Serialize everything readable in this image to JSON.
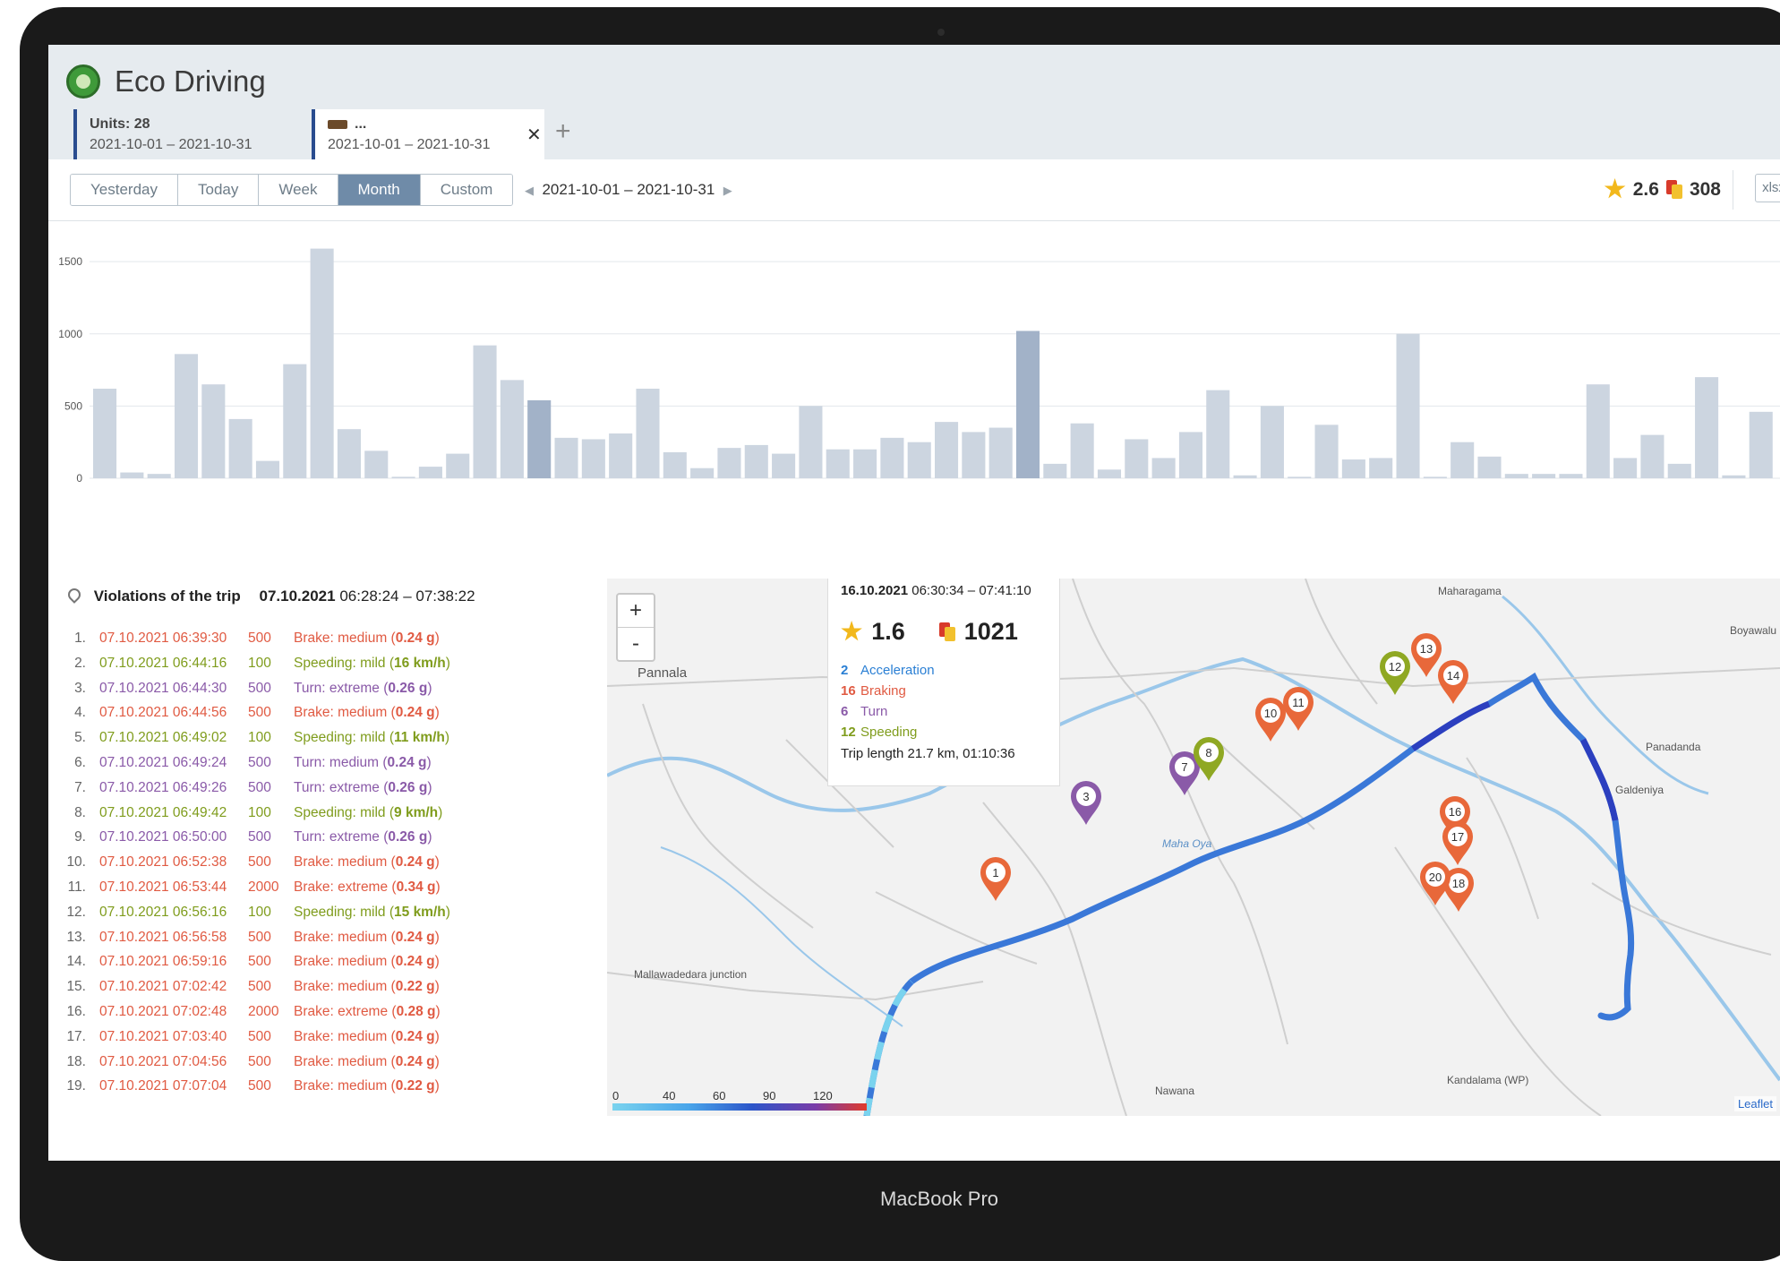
{
  "app": {
    "title": "Eco Driving"
  },
  "tabs": [
    {
      "line1": "Units: 28",
      "line2": "2021-10-01  –  2021-10-31"
    },
    {
      "line1": "...",
      "line2": "2021-10-01  –  2021-10-31"
    }
  ],
  "toolbar": {
    "periods": [
      "Yesterday",
      "Today",
      "Week",
      "Month",
      "Custom"
    ],
    "active_period": "Month",
    "date_range": "2021-10-01  –  2021-10-31",
    "rating": "2.6",
    "penalty": "308",
    "export_label": "xlsx"
  },
  "chart_data": {
    "type": "bar",
    "y_ticks": [
      "0",
      "500",
      "1000",
      "1500"
    ],
    "ylim": [
      0,
      1600
    ],
    "grid": true,
    "values": [
      620,
      40,
      30,
      860,
      650,
      410,
      120,
      790,
      1590,
      340,
      190,
      10,
      80,
      170,
      920,
      680,
      540,
      280,
      270,
      310,
      620,
      180,
      70,
      210,
      230,
      170,
      500,
      200,
      200,
      280,
      250,
      390,
      320,
      350,
      1020,
      100,
      380,
      60,
      270,
      140,
      320,
      610,
      20,
      500,
      10,
      370,
      130,
      140,
      1000,
      10,
      250,
      150,
      30,
      30,
      30,
      650,
      140,
      300,
      100,
      700,
      20,
      460
    ],
    "highlighted": [
      16,
      34
    ]
  },
  "violations": {
    "title": "Violations of the trip",
    "trip_date": "07.10.2021",
    "trip_time": "06:28:24 – 07:38:22",
    "items": [
      {
        "n": "1.",
        "time": "07.10.2021 06:39:30",
        "score": "500",
        "label": "Brake: medium (",
        "value": "0.24 g",
        "close": ")",
        "kind": "brake"
      },
      {
        "n": "2.",
        "time": "07.10.2021 06:44:16",
        "score": "100",
        "label": "Speeding: mild (",
        "value": "16 km/h",
        "close": ")",
        "kind": "speed"
      },
      {
        "n": "3.",
        "time": "07.10.2021 06:44:30",
        "score": "500",
        "label": "Turn: extreme (",
        "value": "0.26 g",
        "close": ")",
        "kind": "turn"
      },
      {
        "n": "4.",
        "time": "07.10.2021 06:44:56",
        "score": "500",
        "label": "Brake: medium (",
        "value": "0.24 g",
        "close": ")",
        "kind": "brake"
      },
      {
        "n": "5.",
        "time": "07.10.2021 06:49:02",
        "score": "100",
        "label": "Speeding: mild (",
        "value": "11 km/h",
        "close": ")",
        "kind": "speed"
      },
      {
        "n": "6.",
        "time": "07.10.2021 06:49:24",
        "score": "500",
        "label": "Turn: medium (",
        "value": "0.24 g",
        "close": ")",
        "kind": "turn"
      },
      {
        "n": "7.",
        "time": "07.10.2021 06:49:26",
        "score": "500",
        "label": "Turn: extreme (",
        "value": "0.26 g",
        "close": ")",
        "kind": "turn"
      },
      {
        "n": "8.",
        "time": "07.10.2021 06:49:42",
        "score": "100",
        "label": "Speeding: mild (",
        "value": "9 km/h",
        "close": ")",
        "kind": "speed"
      },
      {
        "n": "9.",
        "time": "07.10.2021 06:50:00",
        "score": "500",
        "label": "Turn: extreme (",
        "value": "0.26 g",
        "close": ")",
        "kind": "turn"
      },
      {
        "n": "10.",
        "time": "07.10.2021 06:52:38",
        "score": "500",
        "label": "Brake: medium (",
        "value": "0.24 g",
        "close": ")",
        "kind": "brake"
      },
      {
        "n": "11.",
        "time": "07.10.2021 06:53:44",
        "score": "2000",
        "label": "Brake: extreme (",
        "value": "0.34 g",
        "close": ")",
        "kind": "brake"
      },
      {
        "n": "12.",
        "time": "07.10.2021 06:56:16",
        "score": "100",
        "label": "Speeding: mild (",
        "value": "15 km/h",
        "close": ")",
        "kind": "speed"
      },
      {
        "n": "13.",
        "time": "07.10.2021 06:56:58",
        "score": "500",
        "label": "Brake: medium (",
        "value": "0.24 g",
        "close": ")",
        "kind": "brake"
      },
      {
        "n": "14.",
        "time": "07.10.2021 06:59:16",
        "score": "500",
        "label": "Brake: medium (",
        "value": "0.24 g",
        "close": ")",
        "kind": "brake"
      },
      {
        "n": "15.",
        "time": "07.10.2021 07:02:42",
        "score": "500",
        "label": "Brake: medium (",
        "value": "0.22 g",
        "close": ")",
        "kind": "brake"
      },
      {
        "n": "16.",
        "time": "07.10.2021 07:02:48",
        "score": "2000",
        "label": "Brake: extreme (",
        "value": "0.28 g",
        "close": ")",
        "kind": "brake"
      },
      {
        "n": "17.",
        "time": "07.10.2021 07:03:40",
        "score": "500",
        "label": "Brake: medium (",
        "value": "0.24 g",
        "close": ")",
        "kind": "brake"
      },
      {
        "n": "18.",
        "time": "07.10.2021 07:04:56",
        "score": "500",
        "label": "Brake: medium (",
        "value": "0.24 g",
        "close": ")",
        "kind": "brake"
      },
      {
        "n": "19.",
        "time": "07.10.2021 07:07:04",
        "score": "500",
        "label": "Brake: medium (",
        "value": "0.22 g",
        "close": ")",
        "kind": "brake"
      }
    ]
  },
  "map": {
    "zoom_in": "+",
    "zoom_out": "-",
    "attribution": "Leaflet",
    "place_labels": [
      "Maharagama",
      "Pannala",
      "Boyawalu",
      "Panadanda",
      "Galdeniya",
      "Mallawadedara junction",
      "Nawana",
      "Kandalama (WP)",
      "Maha Oya"
    ],
    "speed_legend": [
      "0",
      "40",
      "60",
      "90",
      "120"
    ],
    "popup": {
      "date": "16.10.2021",
      "time": "06:30:34 – 07:41:10",
      "rating": "1.6",
      "penalty": "1021",
      "stats": [
        {
          "count": "2",
          "label": "Acceleration",
          "color": "#2a7fd4"
        },
        {
          "count": "16",
          "label": "Braking",
          "color": "#e05a42"
        },
        {
          "count": "6",
          "label": "Turn",
          "color": "#8a5aa8"
        },
        {
          "count": "12",
          "label": "Speeding",
          "color": "#7f9c1c"
        }
      ],
      "trip_length": "Trip length 21.7 km, 01:10:36"
    },
    "markers": [
      "1",
      "3",
      "7",
      "8",
      "10",
      "11",
      "12",
      "13",
      "14",
      "16",
      "17",
      "18",
      "20"
    ]
  },
  "colors": {
    "brake": "#e05a42",
    "speed": "#7f9c1c",
    "turn": "#8a5aa8",
    "bar": "#ccd5e0",
    "bar_highlight": "#a2b2c8"
  },
  "device": {
    "label": "MacBook Pro"
  }
}
